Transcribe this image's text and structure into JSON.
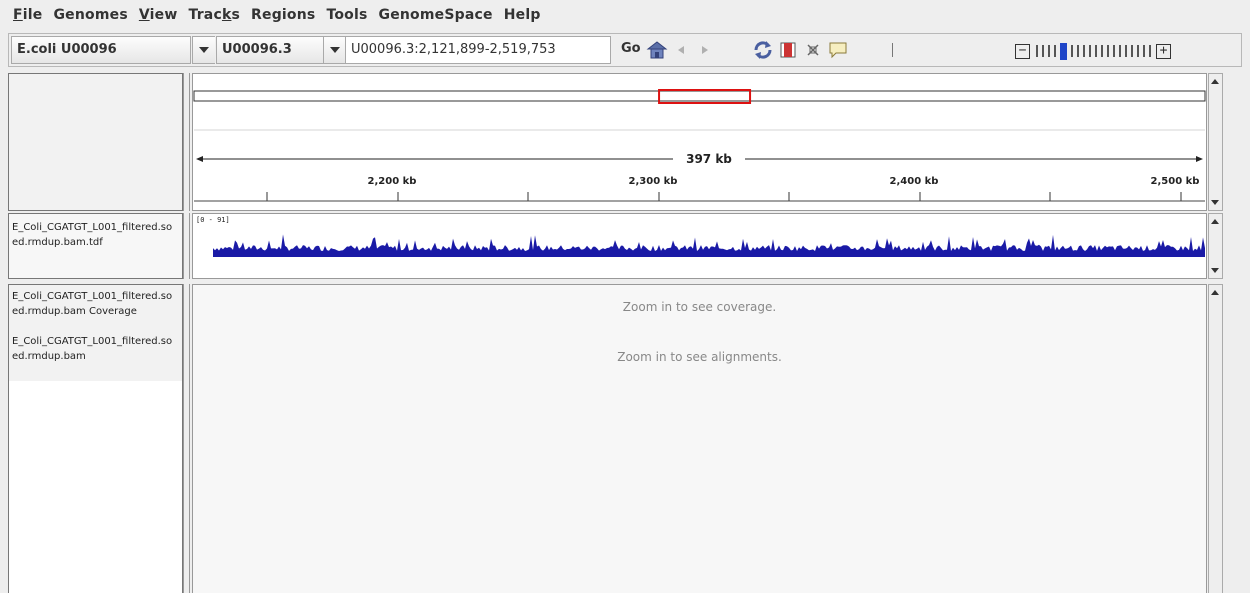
{
  "menu": {
    "items": [
      {
        "label": "File",
        "underline": "F",
        "rest": "ile"
      },
      {
        "label": "Genomes",
        "underline": "",
        "rest": "Genomes"
      },
      {
        "label": "View",
        "underline": "V",
        "rest": "iew"
      },
      {
        "label": "Tracks",
        "underline": "",
        "rest": "Tracks"
      },
      {
        "label": "Regions",
        "underline": "",
        "rest": "Regions"
      },
      {
        "label": "Tools",
        "underline": "",
        "rest": "Tools"
      },
      {
        "label": "GenomeSpace",
        "underline": "",
        "rest": "GenomeSpace"
      },
      {
        "label": "Help",
        "underline": "",
        "rest": "Help"
      }
    ]
  },
  "toolbar": {
    "genome": "E.coli U00096",
    "chromosome": "U00096.3",
    "locus": "U00096.3:2,121,899-2,519,753",
    "go_label": "Go",
    "icons": [
      "home-icon",
      "back-icon",
      "forward-icon",
      "refresh-icon",
      "region-icon",
      "resize-icon",
      "popup-icon"
    ],
    "zoom_minus": "−",
    "zoom_plus": "+",
    "zoom_level": 4,
    "zoom_ticks": 19
  },
  "ruler": {
    "span_label": "397 kb",
    "ticks": [
      "2,200 kb",
      "2,300 kb",
      "2,400 kb",
      "2,500 kb"
    ],
    "region_fraction": [
      0.46,
      0.55
    ]
  },
  "tracks": {
    "tdf": {
      "name_line1": "E_Coli_CGATGT_L001_filtered.so",
      "name_line2": "ed.rmdup.bam.tdf",
      "data_range": "[0 - 91]",
      "color": "#1a1aa6"
    },
    "coverage": {
      "name_line1": "E_Coli_CGATGT_L001_filtered.so",
      "name_line2": "ed.rmdup.bam Coverage",
      "message": "Zoom in to see coverage."
    },
    "alignments": {
      "name_line1": "E_Coli_CGATGT_L001_filtered.so",
      "name_line2": "ed.rmdup.bam",
      "message": "Zoom in to see alignments."
    }
  },
  "colors": {
    "region_box": "#dd1111",
    "zoom_active": "#1f45c8"
  }
}
